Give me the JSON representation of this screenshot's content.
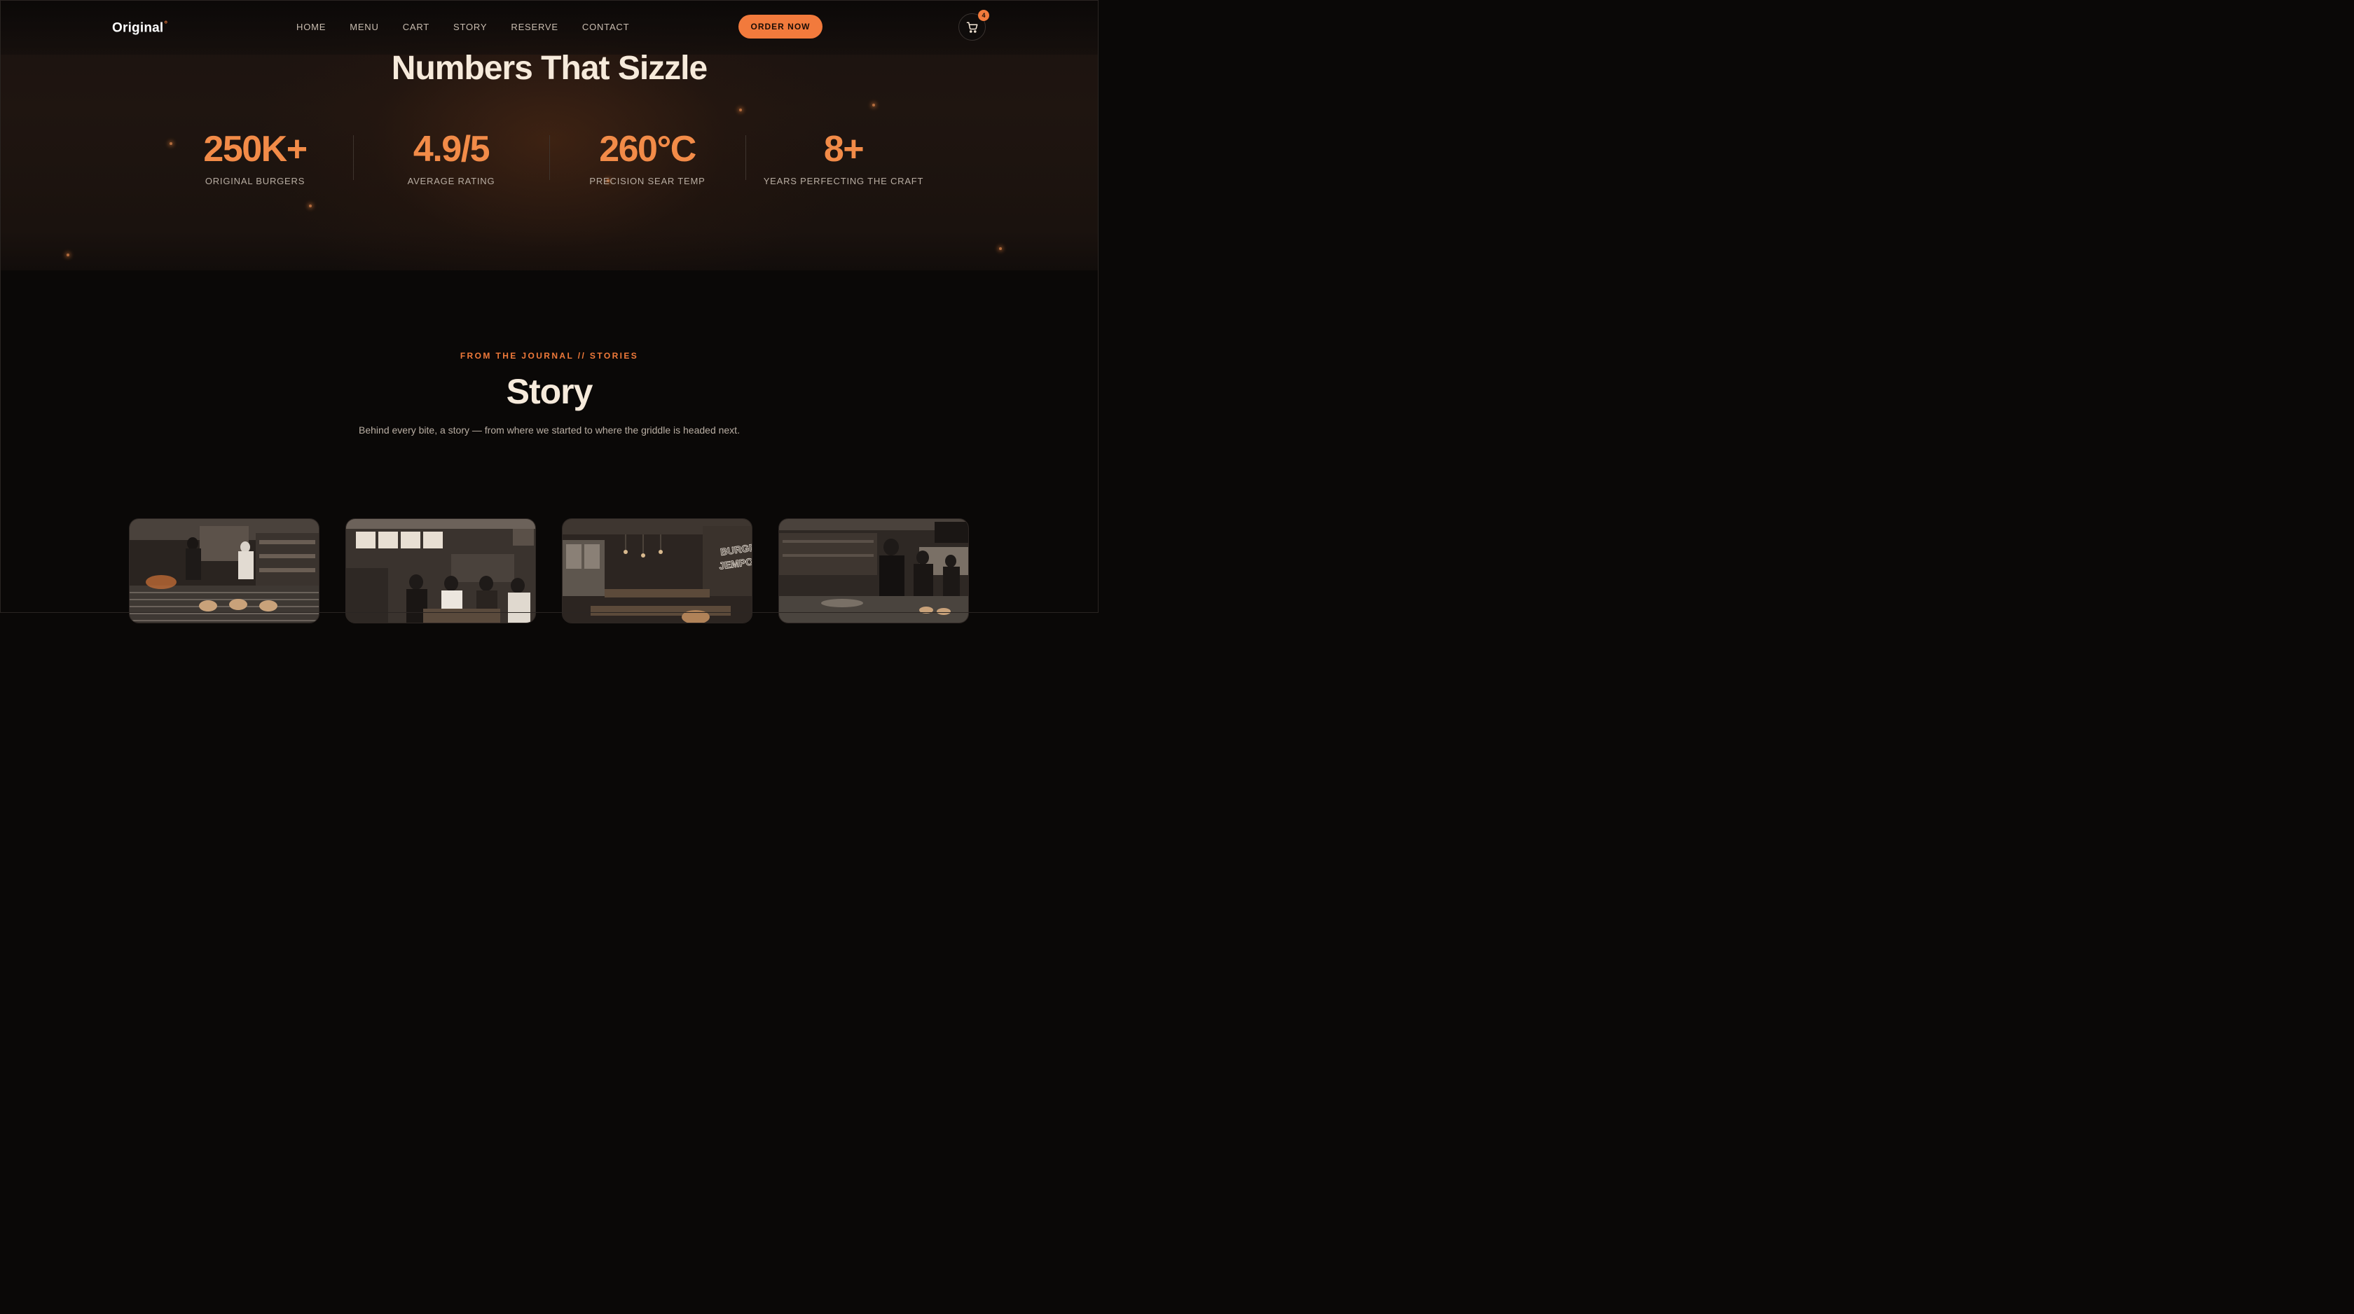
{
  "nav": {
    "logo": "Original",
    "logo_mark": "°",
    "links": [
      "HOME",
      "MENU",
      "CART",
      "STORY",
      "RESERVE",
      "CONTACT"
    ],
    "order_label": "ORDER NOW",
    "cart_count": "4",
    "cart_icon": "cart-icon"
  },
  "stats": {
    "title": "Numbers That Sizzle",
    "items": [
      {
        "value": "250K+",
        "label": "ORIGINAL BURGERS"
      },
      {
        "value": "4.9/5",
        "label": "AVERAGE RATING"
      },
      {
        "value": "260°C",
        "label": "PRECISION SEAR TEMP"
      },
      {
        "value": "8+",
        "label": "YEARS PERFECTING THE CRAFT"
      }
    ]
  },
  "story": {
    "eyebrow": "FROM THE JOURNAL // STORIES",
    "title": "Story",
    "subtitle": "Behind every bite, a story — from where we started to where the griddle is headed next.",
    "cards": [
      {
        "image": "kitchen-grill-photo"
      },
      {
        "image": "diners-eating-photo"
      },
      {
        "image": "restaurant-interior-photo",
        "sign": "BURGER JEMPOLAN"
      },
      {
        "image": "cooks-at-griddle-photo"
      }
    ]
  },
  "colors": {
    "accent": "#f27a3c",
    "stat_value": "#f28b48",
    "background": "#0a0807",
    "heading": "#f6eadb"
  }
}
